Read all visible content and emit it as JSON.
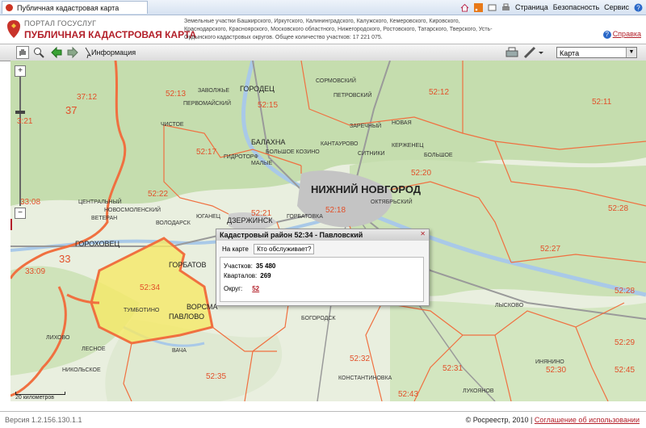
{
  "browser": {
    "tab_title": "Публичная кадастровая карта",
    "menu": {
      "page": "Страница",
      "security": "Безопасность",
      "service": "Сервис"
    }
  },
  "header": {
    "portal": "ПОРТАЛ ГОСУСЛУГ",
    "title": "ПУБЛИЧНАЯ КАДАСТРОВАЯ КАРТА",
    "description": "Земельные участки Башкирского, Иркутского, Калининградского, Калужского, Кемеровского, Кировского, Краснодарского, Красноярского, Московского областного, Нижегородского, Ростовского, Татарского, Тверского, Усть-Ордынского кадастровых округов. Общее количество участков: 17 221 075.",
    "help": "Справка"
  },
  "toolbar": {
    "info": "Информация",
    "map_type": "Карта"
  },
  "map": {
    "regions": [
      {
        "label": "37:12"
      },
      {
        "label": "37",
        "big": true
      },
      {
        "label": "3:21"
      },
      {
        "label": "33:08"
      },
      {
        "label": "33",
        "big": true
      },
      {
        "label": "33:09"
      },
      {
        "label": "52:13"
      },
      {
        "label": "52:15"
      },
      {
        "label": "52:12"
      },
      {
        "label": "52:11"
      },
      {
        "label": "52:17"
      },
      {
        "label": "52:20"
      },
      {
        "label": "52:22"
      },
      {
        "label": "52:21"
      },
      {
        "label": "52:18"
      },
      {
        "label": "52:28"
      },
      {
        "label": "52:27"
      },
      {
        "label": "52:34"
      },
      {
        "label": "52:28"
      },
      {
        "label": "52:35"
      },
      {
        "label": "52:32"
      },
      {
        "label": "52:31"
      },
      {
        "label": "52:30"
      },
      {
        "label": "52:43"
      },
      {
        "label": "52:29"
      },
      {
        "label": "52:45"
      }
    ],
    "cities": {
      "nn": "НИЖНИЙ НОВГОРОД",
      "dzer": "ДЗЕРЖИНСК",
      "gorod": "ГОРОДЕЦ",
      "gorohov": "ГОРОХОВЕЦ",
      "balakhna": "БАЛАХНА",
      "pavlovo": "ПАВЛОВО",
      "vorsma": "ВОРСМА",
      "gorbatov": "ГОРБАТОВ"
    },
    "towns": [
      "ЗАВОЛЖЬЕ",
      "ПЕРВОМАЙСКИЙ",
      "ЧИСТОЕ",
      "СОРМОВСКИЙ",
      "ПЕТРОВСКИЙ",
      "ЗАРЕЧНЫЙ",
      "НОВАЯ",
      "КАНТАУРОВО",
      "КЕРЖЕНЕЦ",
      "СИТНИКИ",
      "БОЛЬШОЕ",
      "ГИДРОТОРФ",
      "МАЛЫЕ",
      "БОЛЬШОЕ КОЗИНО",
      "ЦЕНТРАЛЬНЫЙ",
      "ВЕТЕРАН",
      "ГОРБАТОВКА",
      "ВОЛОДАРСК",
      "ЮГАНЕЦ",
      "ОКТЯБРЬСКИЙ",
      "ТУМБОТИНО",
      "БОГОРОДСК",
      "ЛЫСКОВО",
      "КОНСТАНТИНОВКА",
      "НИКОЛЬСКОЕ",
      "ИНЯНИНО",
      "ЛЕСНОЕ",
      "ЛИХОВО",
      "ВАЧА",
      "НОВОСМОЛЕНСКИЙ",
      "ЛУКОЯНОВ"
    ],
    "scale": "20 километров"
  },
  "popup": {
    "title": "Кадастровый район 52:34 - Павловский",
    "tab_map": "На карте",
    "tab_who": "Кто обслуживает?",
    "parcels_label": "Участков:",
    "parcels": "35 480",
    "blocks_label": "Кварталов:",
    "blocks": "269",
    "okrug_label": "Округ:",
    "okrug": "52"
  },
  "footer": {
    "version": "Версия 1.2.156.130.1.1",
    "copyright": "© Росреестр, 2010 |",
    "agreement": "Соглашение об использовании"
  },
  "colors": {
    "border": "#f07040",
    "highlight": "#f6ea5a",
    "forest": "#c7deb0",
    "water": "#bcd6ee"
  }
}
